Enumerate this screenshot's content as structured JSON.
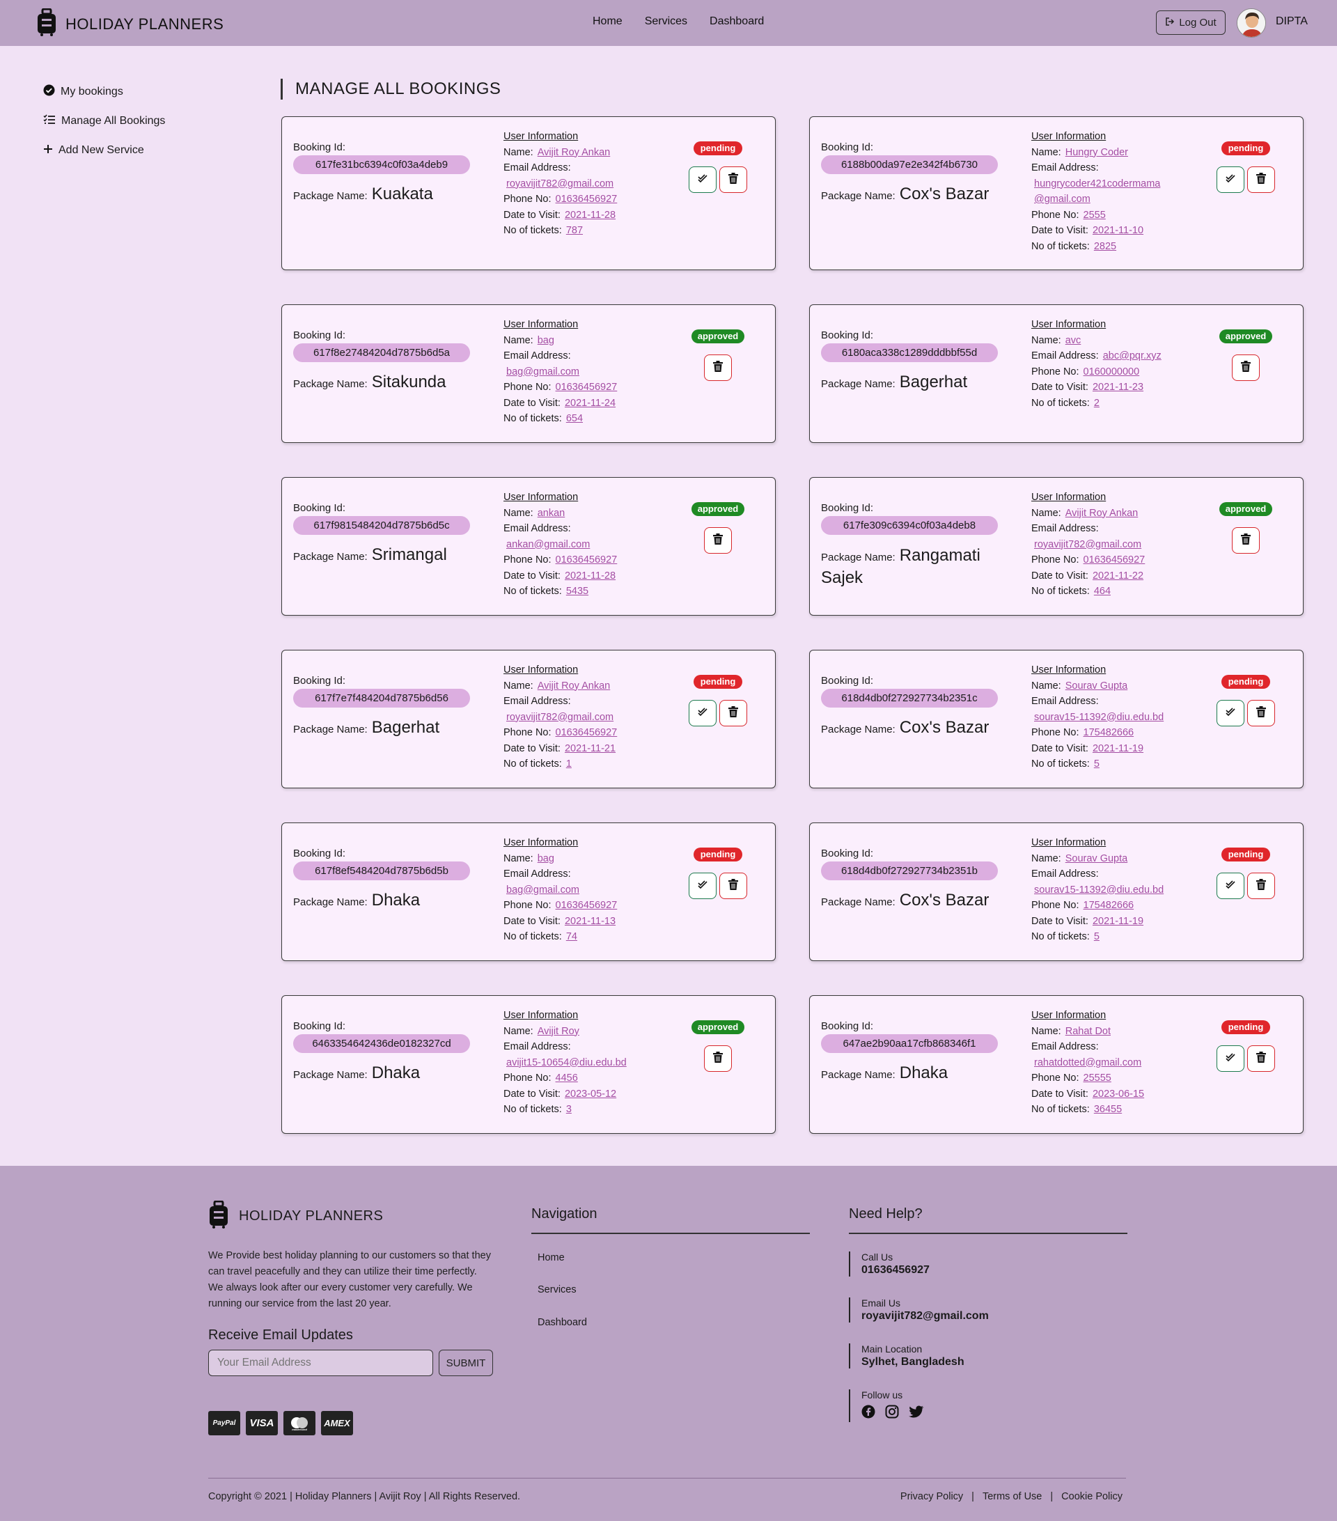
{
  "header": {
    "brand": "HOLIDAY PLANNERS",
    "nav": [
      "Home",
      "Services",
      "Dashboard"
    ],
    "logout_label": "Log Out",
    "user_name": "DIPTA"
  },
  "sidebar": {
    "items": [
      {
        "label": "My bookings",
        "icon": "check-circle-icon"
      },
      {
        "label": "Manage All Bookings",
        "icon": "list-check-icon"
      },
      {
        "label": "Add New Service",
        "icon": "plus-icon"
      }
    ]
  },
  "main": {
    "title": "MANAGE ALL BOOKINGS",
    "labels": {
      "booking_id": "Booking Id:",
      "package_name": "Package Name:",
      "user_info": "User Information",
      "name": "Name:",
      "email": "Email Address:",
      "phone": "Phone No:",
      "date": "Date to Visit:",
      "tickets": "No of tickets:"
    },
    "bookings": [
      {
        "id": "617fe31bc6394c0f03a4deb9",
        "package": "Kuakata",
        "name": "Avijit Roy Ankan",
        "email": "royavijit782@gmail.com",
        "phone": "01636456927",
        "date": "2021-11-28",
        "tickets": "787",
        "status": "pending"
      },
      {
        "id": "6188b00da97e2e342f4b6730",
        "package": "Cox's Bazar",
        "name": "Hungry Coder",
        "email_1": "hungrycoder421codermama",
        "email_2": "@gmail.com",
        "phone": "2555",
        "date": "2021-11-10",
        "tickets": "2825",
        "status": "pending"
      },
      {
        "id": "617f8e27484204d7875b6d5a",
        "package": "Sitakunda",
        "name": "bag",
        "email": "bag@gmail.com",
        "phone": "01636456927",
        "date": "2021-11-24",
        "tickets": "654",
        "status": "approved"
      },
      {
        "id": "6180aca338c1289dddbbf55d",
        "package": "Bagerhat",
        "name": "avc",
        "email": "abc@pqr.xyz",
        "phone": "0160000000",
        "date": "2021-11-23",
        "tickets": "2",
        "status": "approved"
      },
      {
        "id": "617f9815484204d7875b6d5c",
        "package": "Srimangal",
        "name": "ankan",
        "email": "ankan@gmail.com",
        "phone": "01636456927",
        "date": "2021-11-28",
        "tickets": "5435",
        "status": "approved"
      },
      {
        "id": "617fe309c6394c0f03a4deb8",
        "package_1": "Rangamati",
        "package_2": "Sajek",
        "name": "Avijit Roy Ankan",
        "email": "royavijit782@gmail.com",
        "phone": "01636456927",
        "date": "2021-11-22",
        "tickets": "464",
        "status": "approved"
      },
      {
        "id": "617f7e7f484204d7875b6d56",
        "package": "Bagerhat",
        "name": "Avijit Roy Ankan",
        "email": "royavijit782@gmail.com",
        "phone": "01636456927",
        "date": "2021-11-21",
        "tickets": "1",
        "status": "pending"
      },
      {
        "id": "618d4db0f272927734b2351c",
        "package": "Cox's Bazar",
        "name": "Sourav Gupta",
        "email": "sourav15-11392@diu.edu.bd",
        "phone": "175482666",
        "date": "2021-11-19",
        "tickets": "5",
        "status": "pending"
      },
      {
        "id": "617f8ef5484204d7875b6d5b",
        "package": "Dhaka",
        "name": "bag",
        "email": "bag@gmail.com",
        "phone": "01636456927",
        "date": "2021-11-13",
        "tickets": "74",
        "status": "pending"
      },
      {
        "id": "618d4db0f272927734b2351b",
        "package": "Cox's Bazar",
        "name": "Sourav Gupta",
        "email": "sourav15-11392@diu.edu.bd",
        "phone": "175482666",
        "date": "2021-11-19",
        "tickets": "5",
        "status": "pending"
      },
      {
        "id": "6463354642436de0182327cd",
        "package": "Dhaka",
        "name": "Avijit Roy",
        "email": "avijit15-10654@diu.edu.bd",
        "phone": "4456",
        "date": "2023-05-12",
        "tickets": "3",
        "status": "approved"
      },
      {
        "id": "647ae2b90aa17cfb868346f1",
        "package": "Dhaka",
        "name": "Rahat Dot",
        "email": "rahatdotted@gmail.com",
        "phone": "25555",
        "date": "2023-06-15",
        "tickets": "36455",
        "status": "pending"
      }
    ]
  },
  "footer": {
    "brand": "HOLIDAY PLANNERS",
    "description": "We Provide best holiday planning to our customers so that they can travel peacefully and they can utilize their time perfectly. We always look after our every customer very carefully. We running our service from the last 20 year.",
    "receive_title": "Receive Email Updates",
    "email_placeholder": "Your Email Address",
    "submit_label": "SUBMIT",
    "payment_cards": [
      "PayPal",
      "VISA",
      "mastercard",
      "AMEX"
    ],
    "navigation_title": "Navigation",
    "navigation": [
      "Home",
      "Services",
      "Dashboard"
    ],
    "help_title": "Need Help?",
    "call_label": "Call Us",
    "call_value": "01636456927",
    "email_label": "Email Us",
    "email_value": "royavijit782@gmail.com",
    "location_label": "Main Location",
    "location_value": "Sylhet, Bangladesh",
    "follow_label": "Follow us",
    "copyright": "Copyright © 2021 | Holiday Planners | Avijit Roy | All Rights Reserved.",
    "policies": [
      "Privacy Policy",
      "Terms of Use",
      "Cookie Policy"
    ]
  }
}
